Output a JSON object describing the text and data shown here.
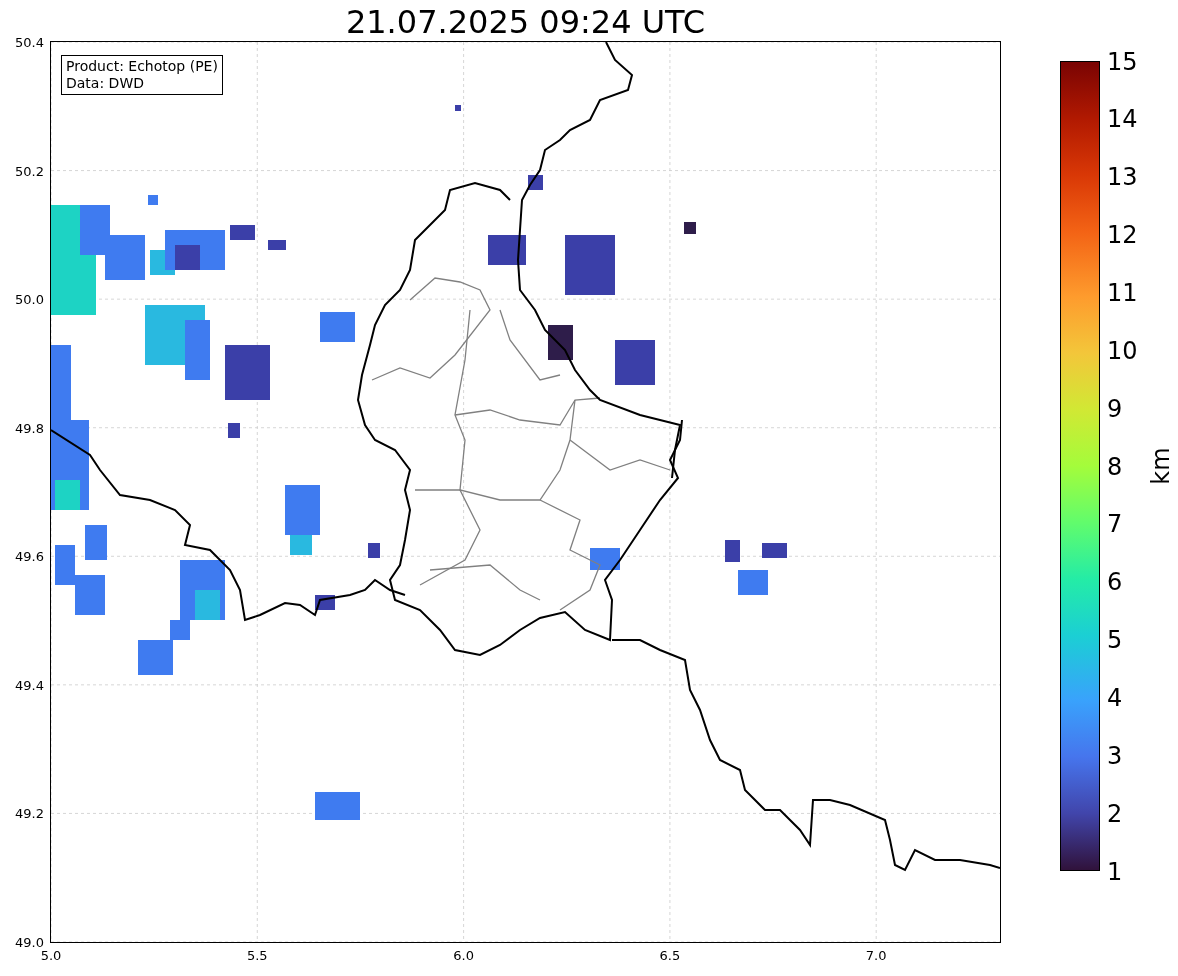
{
  "title": "21.07.2025 09:24 UTC",
  "info_box": [
    "Product: Echotop (PE)",
    "Data: DWD"
  ],
  "map": {
    "x_ticks": [
      "5.0",
      "5.5",
      "6.0",
      "6.5",
      "7.0"
    ],
    "y_ticks": [
      "50.4",
      "50.2",
      "50.0",
      "49.8",
      "49.6",
      "49.4",
      "49.2",
      "49.0"
    ]
  },
  "colorbar": {
    "ticks": [
      "15",
      "14",
      "13",
      "12",
      "11",
      "10",
      "9",
      "8",
      "7",
      "6",
      "5",
      "4",
      "3",
      "2",
      "1"
    ],
    "label": "km"
  }
}
